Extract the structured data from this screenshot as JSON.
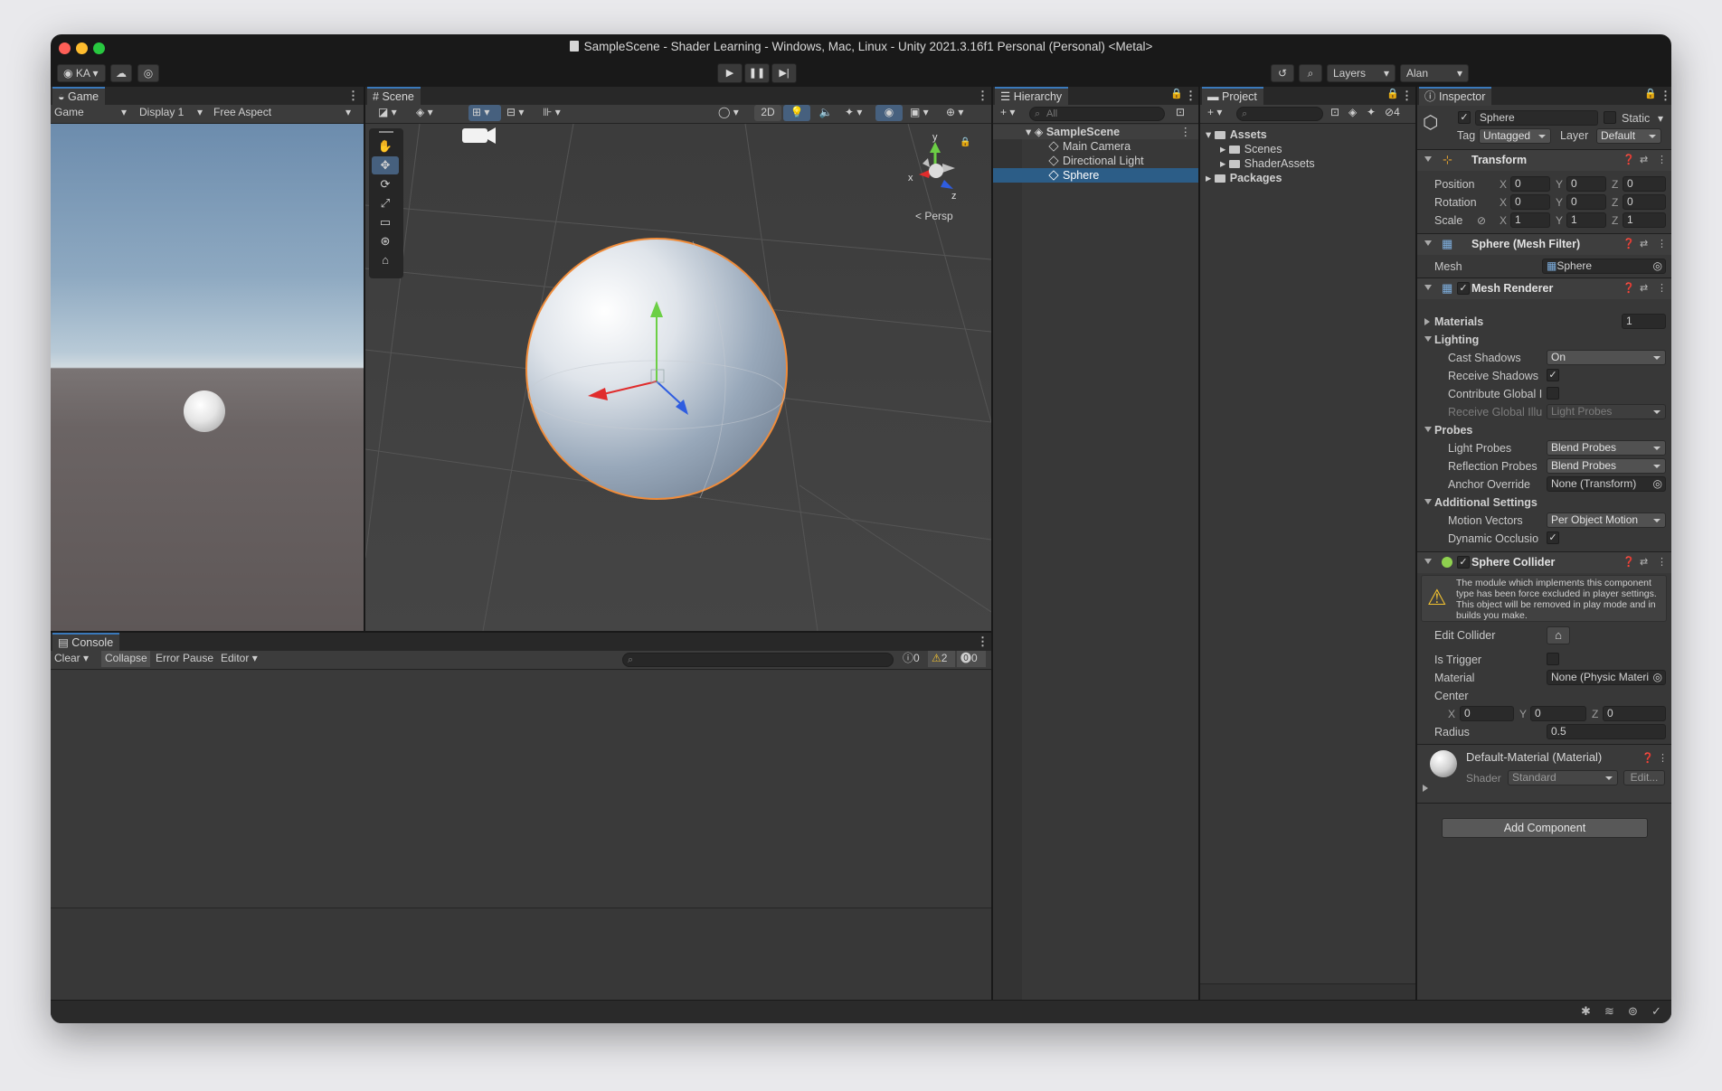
{
  "window": {
    "title": "SampleScene - Shader Learning - Windows, Mac, Linux - Unity 2021.3.16f1 Personal (Personal) <Metal>"
  },
  "toolbar": {
    "account": "KA",
    "layers": "Layers",
    "layout": "Alan"
  },
  "game": {
    "tab": "Game",
    "view_mode": "Game",
    "display": "Display 1",
    "aspect": "Free Aspect"
  },
  "scene": {
    "tab": "Scene",
    "mode_2d": "2D",
    "persp": "< Persp",
    "gizmo_axes": {
      "x": "x",
      "y": "y",
      "z": "z"
    }
  },
  "hierarchy": {
    "tab": "Hierarchy",
    "search_placeholder": "All",
    "scene_name": "SampleScene",
    "items": [
      "Main Camera",
      "Directional Light",
      "Sphere"
    ],
    "selected": "Sphere"
  },
  "project": {
    "tab": "Project",
    "badge": "4",
    "assets": "Assets",
    "folders": [
      "Scenes",
      "ShaderAssets"
    ],
    "packages": "Packages"
  },
  "console": {
    "tab": "Console",
    "clear": "Clear",
    "collapse": "Collapse",
    "error_pause": "Error Pause",
    "editor": "Editor",
    "count_info": "0",
    "count_warn": "2",
    "count_error": "0"
  },
  "inspector": {
    "tab": "Inspector",
    "object_name": "Sphere",
    "static_label": "Static",
    "tag_label": "Tag",
    "tag_value": "Untagged",
    "layer_label": "Layer",
    "layer_value": "Default",
    "transform": {
      "title": "Transform",
      "position_label": "Position",
      "rotation_label": "Rotation",
      "scale_label": "Scale",
      "position": [
        "0",
        "0",
        "0"
      ],
      "rotation": [
        "0",
        "0",
        "0"
      ],
      "scale": [
        "1",
        "1",
        "1"
      ]
    },
    "mesh_filter": {
      "title": "Sphere (Mesh Filter)",
      "mesh_label": "Mesh",
      "mesh_value": "Sphere"
    },
    "mesh_renderer": {
      "title": "Mesh Renderer",
      "materials_label": "Materials",
      "materials_count": "1",
      "lighting": "Lighting",
      "cast_shadows_label": "Cast Shadows",
      "cast_shadows_value": "On",
      "receive_shadows_label": "Receive Shadows",
      "contribute_gi_label": "Contribute Global I",
      "receive_gi_label": "Receive Global Illu",
      "receive_gi_value": "Light Probes",
      "probes": "Probes",
      "light_probes_label": "Light Probes",
      "light_probes_value": "Blend Probes",
      "reflection_probes_label": "Reflection Probes",
      "reflection_probes_value": "Blend Probes",
      "anchor_override_label": "Anchor Override",
      "anchor_override_value": "None (Transform)",
      "additional_settings": "Additional Settings",
      "motion_vectors_label": "Motion Vectors",
      "motion_vectors_value": "Per Object Motion",
      "dynamic_occlusion_label": "Dynamic Occlusio"
    },
    "sphere_collider": {
      "title": "Sphere Collider",
      "warning": "The module which implements this component type has been force excluded in player settings. This object will be removed in play mode and in builds you make.",
      "edit_collider_label": "Edit Collider",
      "is_trigger_label": "Is Trigger",
      "material_label": "Material",
      "material_value": "None (Physic Materi",
      "center_label": "Center",
      "center": [
        "0",
        "0",
        "0"
      ],
      "radius_label": "Radius",
      "radius": "0.5"
    },
    "material": {
      "title": "Default-Material (Material)",
      "shader_label": "Shader",
      "shader_value": "Standard",
      "edit": "Edit..."
    },
    "add_component": "Add Component"
  }
}
